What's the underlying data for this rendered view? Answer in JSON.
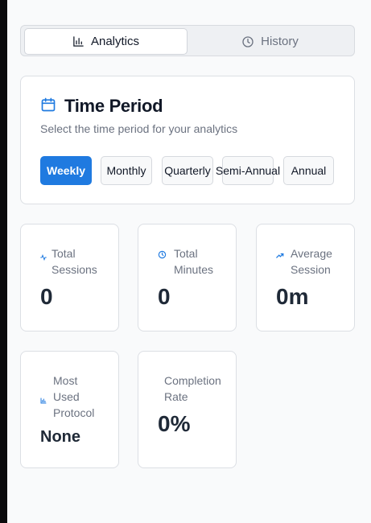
{
  "tabs": {
    "analytics": {
      "label": "Analytics",
      "icon": "bar-chart-icon"
    },
    "history": {
      "label": "History",
      "icon": "clock-icon"
    }
  },
  "time_period": {
    "title": "Time Period",
    "description": "Select the time period for your analytics",
    "icon": "calendar-icon",
    "options": [
      "Weekly",
      "Monthly",
      "Quarterly",
      "Semi-Annual",
      "Annual"
    ],
    "selected": "Weekly"
  },
  "stats": {
    "total_sessions": {
      "label": "Total Sessions",
      "value": "0",
      "icon": "activity-icon"
    },
    "total_minutes": {
      "label": "Total Minutes",
      "value": "0",
      "icon": "clock-icon"
    },
    "average_session": {
      "label": "Average Session",
      "value": "0m",
      "icon": "trending-up-icon"
    },
    "most_used_protocol": {
      "label": "Most Used Protocol",
      "value": "None",
      "icon": "bar-chart-icon"
    },
    "completion_rate": {
      "label": "Completion Rate",
      "value": "0%"
    }
  },
  "colors": {
    "accent": "#1f7ae0",
    "background": "#f9fafb",
    "card": "#ffffff",
    "muted_text": "#6b7280"
  }
}
